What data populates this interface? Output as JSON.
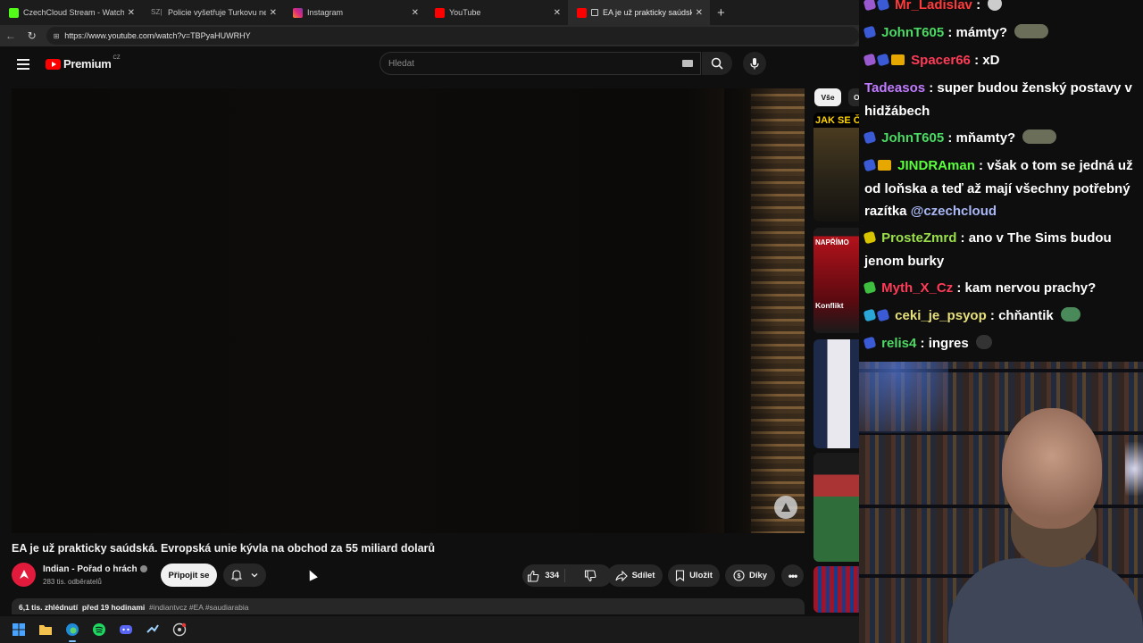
{
  "browser": {
    "tabs": [
      {
        "title": "CzechCloud Stream - Watch Live o",
        "fav_color": "#53fc18",
        "active": false
      },
      {
        "title": "Policie vyšetřuje Turkovu nehodu",
        "fav_color": "#555555",
        "fav_text": "SZ|",
        "active": false
      },
      {
        "title": "Instagram",
        "fav_color": "#e1306c",
        "active": false
      },
      {
        "title": "YouTube",
        "fav_color": "#ff0000",
        "active": false
      },
      {
        "title": "EA je už prakticky saúdská. Ev",
        "fav_color": "#ff0000",
        "active": true
      }
    ],
    "close_glyph": "✕",
    "newtab_glyph": "+",
    "url": "https://www.youtube.com/watch?v=TBPyaHUWRHY"
  },
  "youtube": {
    "logo_text": "Premium",
    "logo_region": "CZ",
    "search_placeholder": "Hledat"
  },
  "video": {
    "title": "EA je už prakticky saúdská. Evropská unie kývla na obchod za 55 miliard dolarů",
    "channel_name": "Indian - Pořad o hrách",
    "subscribers": "283 tis. odběratelů",
    "join_label": "Připojit se",
    "likes": "334",
    "share_label": "Sdílet",
    "save_label": "Uložit",
    "thanks_label": "Díky",
    "views": "6,1 tis. zhlédnutí",
    "published": "před 19 hodinami",
    "tags": "#indiantvcz #EA #saudiarabia"
  },
  "sidebar": {
    "chip_all": "Vše",
    "chip_next": "O",
    "thumbs": [
      {
        "label": "JAK SE ČES",
        "label_color": "#ffd400",
        "bg": "#3a3a2a"
      },
      {
        "label": "NAPŘÍMO",
        "label_color": "#ffffff",
        "bg": "#b3121b",
        "sub": "Konflikt"
      },
      {
        "label": "",
        "label_color": "#ffffff",
        "bg": "#1d2a4a"
      },
      {
        "label": "",
        "label_color": "#ffffff",
        "bg": "#2f6e3a"
      },
      {
        "label": "",
        "label_color": "#ffffff",
        "bg": "#a0142a"
      }
    ]
  },
  "chat": {
    "messages": [
      {
        "badges": [
          "purple",
          "blue"
        ],
        "user": "Mr_Ladislav",
        "color": "#ff3b3b",
        "text": ":",
        "emote": "#cccccc"
      },
      {
        "badges": [
          "blue"
        ],
        "user": "JohnT605",
        "color": "#4cd964",
        "text": ": mámty?",
        "emote": "#6b6f5a"
      },
      {
        "badges": [
          "purple",
          "blue",
          "crown"
        ],
        "user": "Spacer66",
        "color": "#ff3b57",
        "text": ": xD"
      },
      {
        "badges": [],
        "user": "Tadeasos",
        "color": "#c07bff",
        "text": ": super budou ženský postavy v hidžábech"
      },
      {
        "badges": [
          "blue"
        ],
        "user": "JohnT605",
        "color": "#4cd964",
        "text": ": mňamty?",
        "emote": "#6b6f5a"
      },
      {
        "badges": [
          "blue",
          "crown"
        ],
        "user": "JINDRAman",
        "color": "#59ff3b",
        "text": ": však o tom se jedná už od loňska a teď až mají všechny potřebný razítka",
        "mention": "@czechcloud"
      },
      {
        "badges": [
          "yellow"
        ],
        "user": "ProsteZmrd",
        "color": "#9be04a",
        "text": ": ano v The Sims budou jenom burky"
      },
      {
        "badges": [
          "green"
        ],
        "user": "Myth_X_Cz",
        "color": "#ff3b57",
        "text": ": kam nervou prachy?"
      },
      {
        "badges": [
          "cyan",
          "blue"
        ],
        "user": "ceki_je_psyop",
        "color": "#e6e07a",
        "text": ": chňantik",
        "emote": "#4a8a5a"
      },
      {
        "badges": [
          "blue"
        ],
        "user": "relis4",
        "color": "#4cd964",
        "text": ": ingres",
        "emote": "#222222"
      }
    ]
  },
  "taskbar": {
    "icons": [
      "windows-start-icon",
      "file-explorer-icon",
      "edge-browser-icon",
      "spotify-icon",
      "discord-icon",
      "steam-icon",
      "obs-icon"
    ]
  }
}
